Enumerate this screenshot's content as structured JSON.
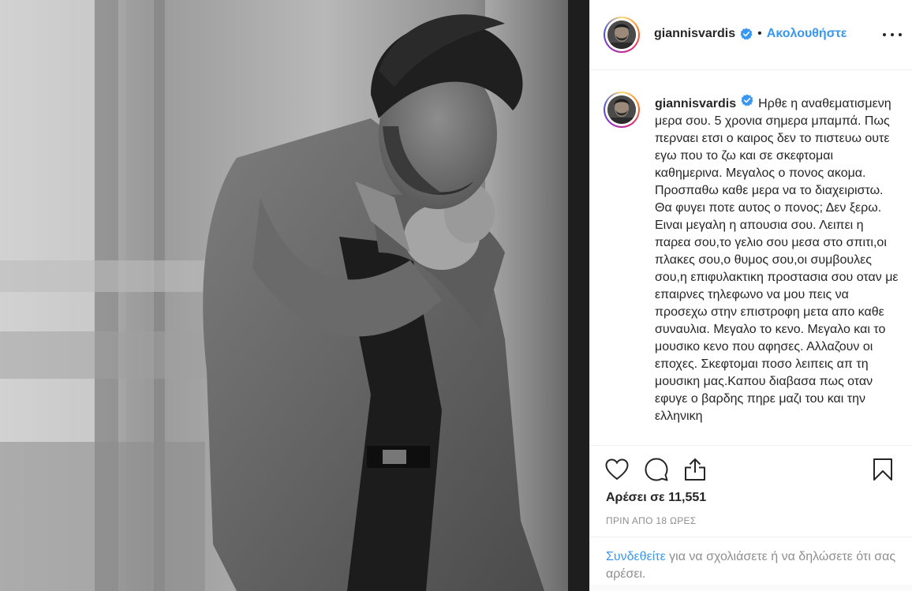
{
  "post": {
    "author": {
      "username": "giannisvardis",
      "verified": true,
      "verified_icon": "verified-badge-icon",
      "follow_label": "Ακολουθήστε",
      "separator": "•"
    },
    "caption": {
      "username": "giannisvardis",
      "text": "Ηρθε η αναθεματισμενη μερα σου. 5 χρονια σημερα μπαμπά. Πως περναει ετσι ο καιρος δεν το πιστευω ουτε εγω που το ζω και σε σκεφτομαι καθημερινα. Μεγαλος ο πονος ακομα. Προσπαθω καθε μερα να το διαχειριστω. Θα φυγει ποτε αυτος ο πονος; Δεν ξερω. Ειναι μεγαλη η απουσια σου. Λειπει η παρεα σου,το γελιο σου μεσα στο σπιτι,οι πλακες σου,ο θυμος σου,οι συμβουλες σου,η επιφυλακτικη προστασια σου οταν με επαιρνες τηλεφωνο να μου πεις να προσεχω στην επιστροφη μετα απο καθε συναυλια. Μεγαλο το κενο. Μεγαλο και το μουσικο κενο που αφησες. Αλλαζουν οι εποχες. Σκεφτομαι ποσο λειπεις απ τη μουσικη μας.Καπου διαβασα πως οταν εφυγε ο βαρδης πηρε μαζι του και την ελληνικη"
    },
    "likes_label": "Αρέσει σε 11,551",
    "timestamp": "ΠΡΙΝ ΑΠΟ 18 ΩΡΕΣ",
    "login_prompt": {
      "link": "Συνδεθείτε",
      "rest": " για να σχολιάσετε ή να δηλώσετε ότι σας αρέσει."
    },
    "icons": {
      "like": "heart-icon",
      "comment": "comment-icon",
      "share": "share-icon",
      "save": "bookmark-icon",
      "more": "more-options-icon"
    },
    "colors": {
      "accent": "#3897f0",
      "text": "#262626",
      "muted": "#8e8e8e",
      "border": "#efefef"
    }
  }
}
